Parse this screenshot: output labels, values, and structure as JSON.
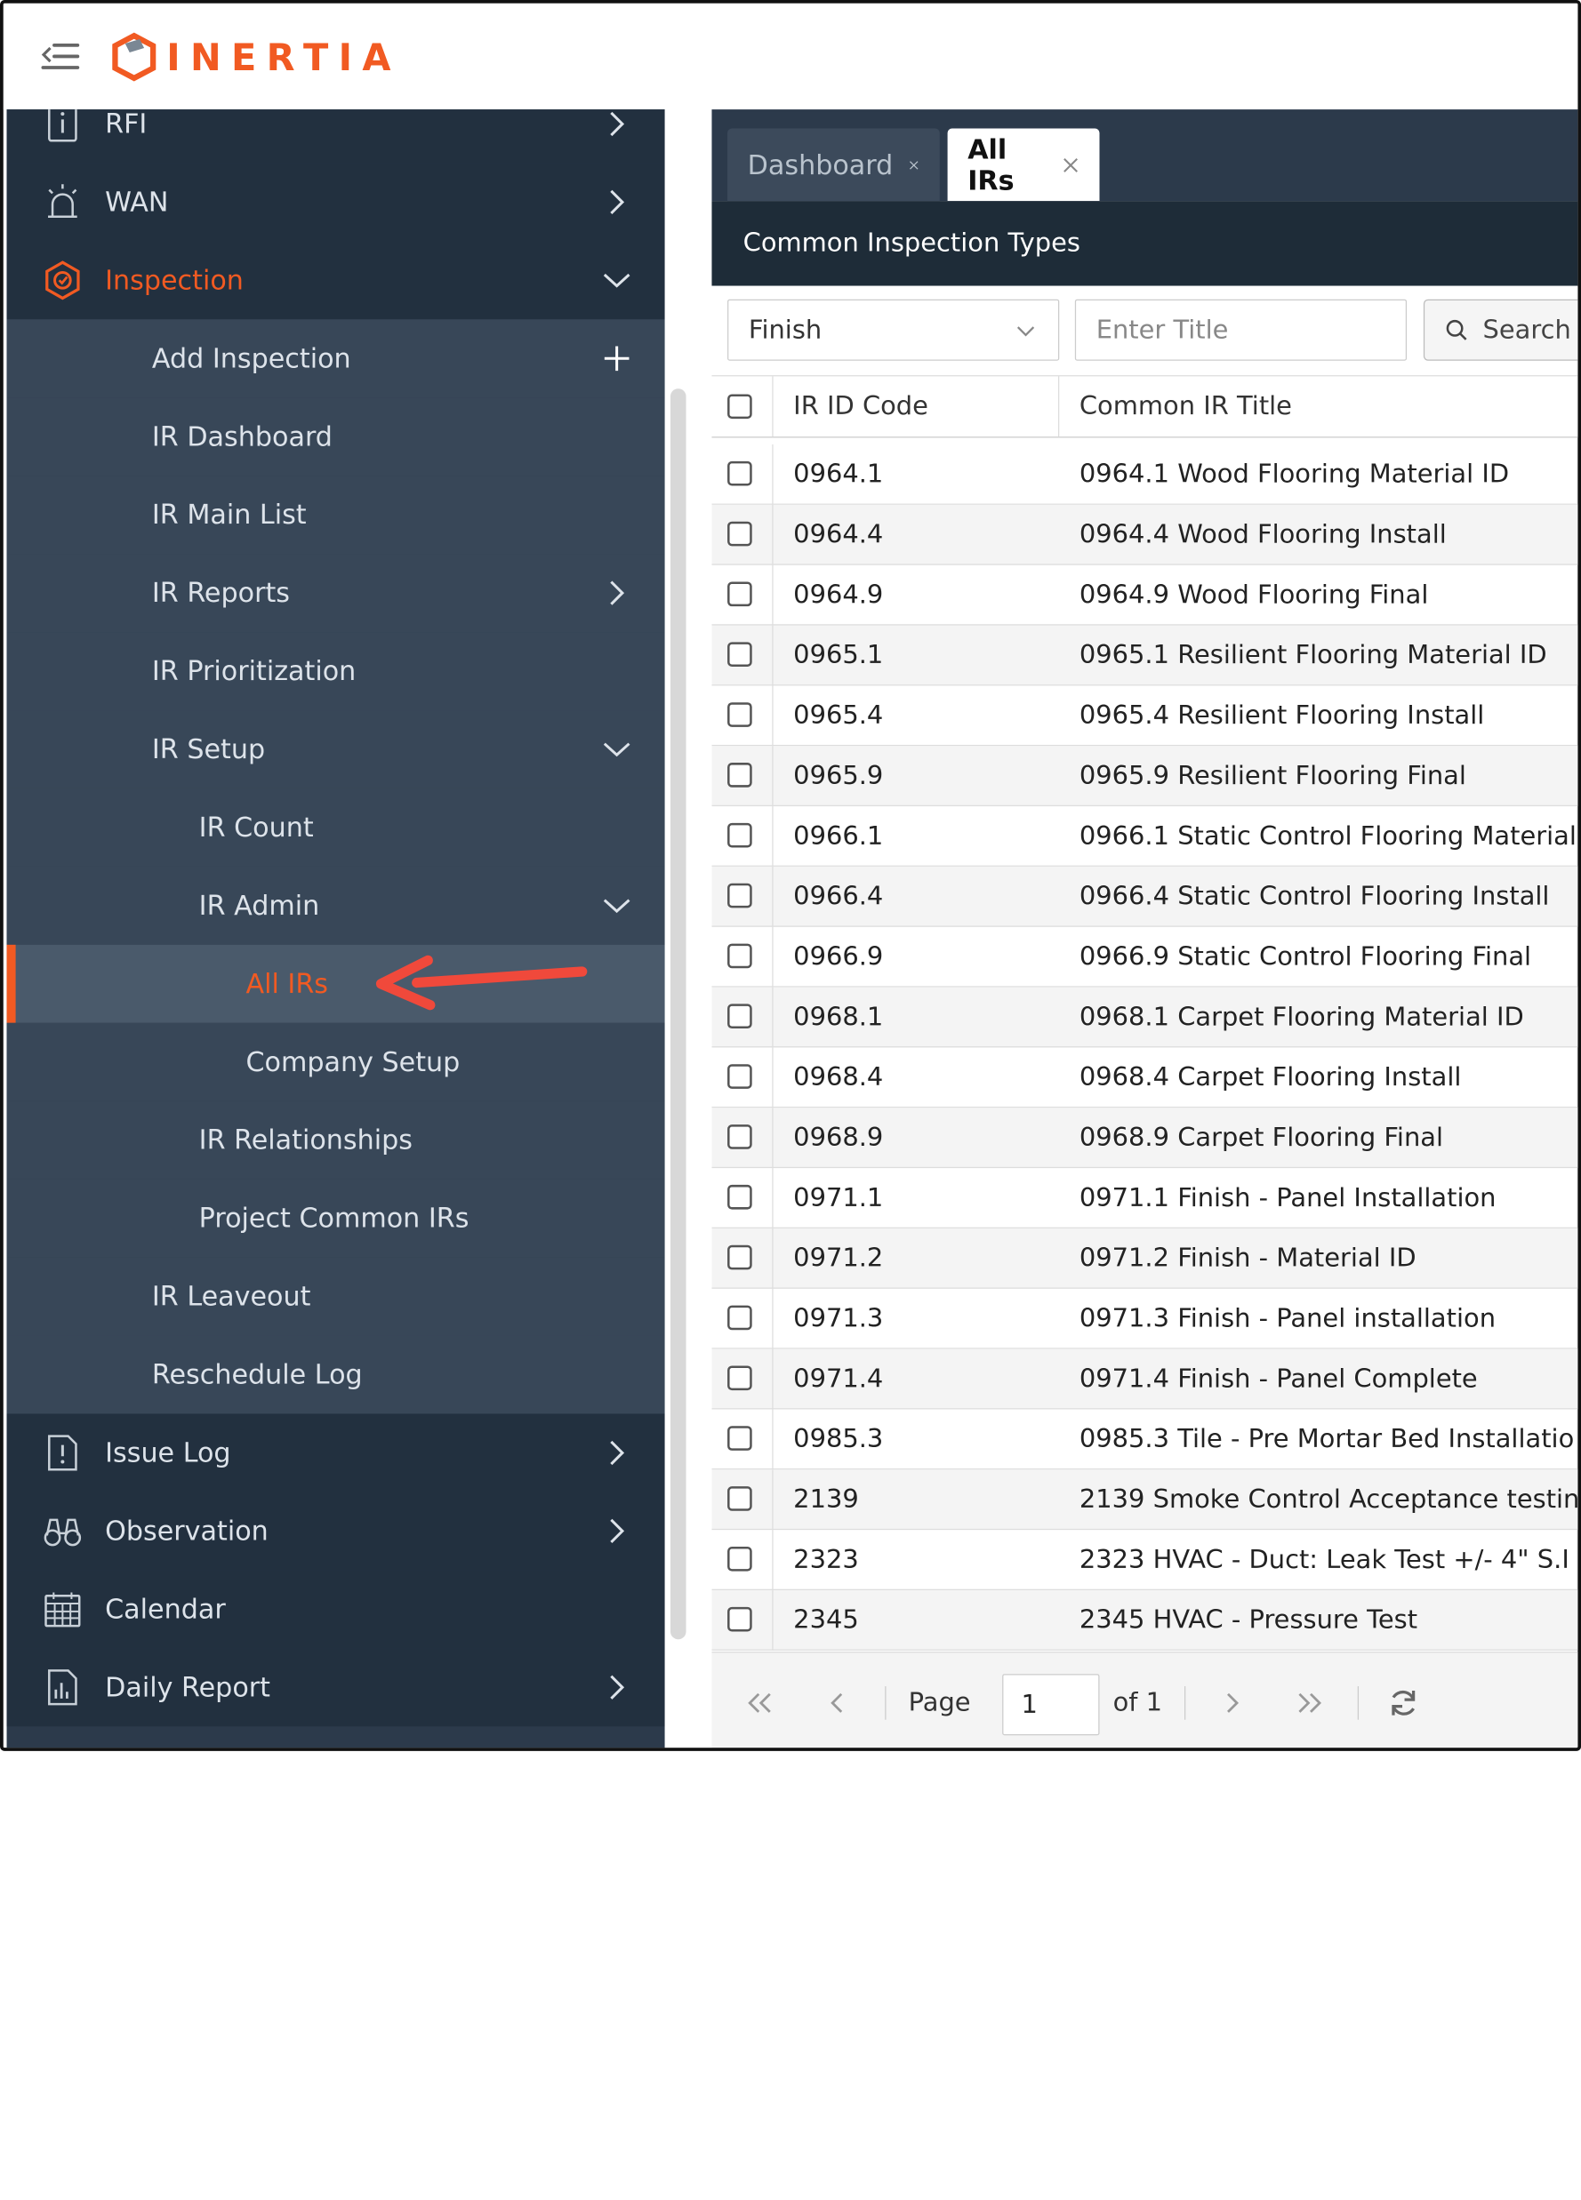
{
  "app": {
    "logo_text": "INERTIA",
    "brand_color": "#f15a22"
  },
  "sidebar": {
    "items": [
      {
        "label": "RFI",
        "icon": "info-document-icon",
        "level": 0,
        "chevron": "right"
      },
      {
        "label": "WAN",
        "icon": "alarm-icon",
        "level": 0,
        "chevron": "right"
      },
      {
        "label": "Inspection",
        "icon": "inspection-badge-icon",
        "level": 0,
        "chevron": "down",
        "highlighted": true
      },
      {
        "label": "Add Inspection",
        "level": 1,
        "action": "plus"
      },
      {
        "label": "IR Dashboard",
        "level": 1
      },
      {
        "label": "IR Main List",
        "level": 1
      },
      {
        "label": "IR Reports",
        "level": 1,
        "chevron": "right"
      },
      {
        "label": "IR Prioritization",
        "level": 1
      },
      {
        "label": "IR Setup",
        "level": 1,
        "chevron": "down"
      },
      {
        "label": "IR Count",
        "level": 2
      },
      {
        "label": "IR Admin",
        "level": 2,
        "chevron": "down"
      },
      {
        "label": "All IRs",
        "level": 3,
        "active": true
      },
      {
        "label": "Company Setup",
        "level": 3
      },
      {
        "label": "IR Relationships",
        "level": 2
      },
      {
        "label": "Project Common IRs",
        "level": 2
      },
      {
        "label": "IR Leaveout",
        "level": 1
      },
      {
        "label": "Reschedule Log",
        "level": 1
      },
      {
        "label": "Issue Log",
        "icon": "issue-document-icon",
        "level": 0,
        "chevron": "right"
      },
      {
        "label": "Observation",
        "icon": "binoculars-icon",
        "level": 0,
        "chevron": "right"
      },
      {
        "label": "Calendar",
        "icon": "calendar-icon",
        "level": 0
      },
      {
        "label": "Daily Report",
        "icon": "report-document-icon",
        "level": 0,
        "chevron": "right"
      }
    ]
  },
  "tabs": [
    {
      "label": "Dashboard",
      "active": false
    },
    {
      "label": "All IRs",
      "active": true
    }
  ],
  "panel": {
    "title": "Common Inspection Types"
  },
  "filters": {
    "category_value": "Finish",
    "title_placeholder": "Enter Title",
    "search_label": "Search"
  },
  "table": {
    "columns": [
      "IR ID Code",
      "Common IR Title"
    ],
    "rows": [
      {
        "code": "0964.1",
        "title": "0964.1 Wood Flooring Material ID"
      },
      {
        "code": "0964.4",
        "title": "0964.4 Wood Flooring Install"
      },
      {
        "code": "0964.9",
        "title": "0964.9 Wood Flooring Final"
      },
      {
        "code": "0965.1",
        "title": "0965.1 Resilient Flooring Material ID"
      },
      {
        "code": "0965.4",
        "title": "0965.4 Resilient Flooring Install"
      },
      {
        "code": "0965.9",
        "title": "0965.9 Resilient Flooring Final"
      },
      {
        "code": "0966.1",
        "title": "0966.1 Static Control Flooring Material"
      },
      {
        "code": "0966.4",
        "title": "0966.4 Static Control Flooring Install"
      },
      {
        "code": "0966.9",
        "title": "0966.9 Static Control Flooring Final"
      },
      {
        "code": "0968.1",
        "title": "0968.1 Carpet Flooring Material ID"
      },
      {
        "code": "0968.4",
        "title": "0968.4 Carpet Flooring Install"
      },
      {
        "code": "0968.9",
        "title": "0968.9 Carpet Flooring Final"
      },
      {
        "code": "0971.1",
        "title": "0971.1 Finish - Panel Installation"
      },
      {
        "code": "0971.2",
        "title": "0971.2 Finish - Material ID"
      },
      {
        "code": "0971.3",
        "title": "0971.3 Finish - Panel installation"
      },
      {
        "code": "0971.4",
        "title": "0971.4 Finish - Panel Complete"
      },
      {
        "code": "0985.3",
        "title": "0985.3 Tile - Pre Mortar Bed Installatio"
      },
      {
        "code": "2139",
        "title": "2139 Smoke Control Acceptance testin"
      },
      {
        "code": "2323",
        "title": "2323 HVAC - Duct: Leak Test +/- 4\" S.I"
      },
      {
        "code": "2345",
        "title": "2345 HVAC - Pressure Test"
      }
    ]
  },
  "pager": {
    "page_label": "Page",
    "page_value": "1",
    "of_label": "of 1"
  }
}
